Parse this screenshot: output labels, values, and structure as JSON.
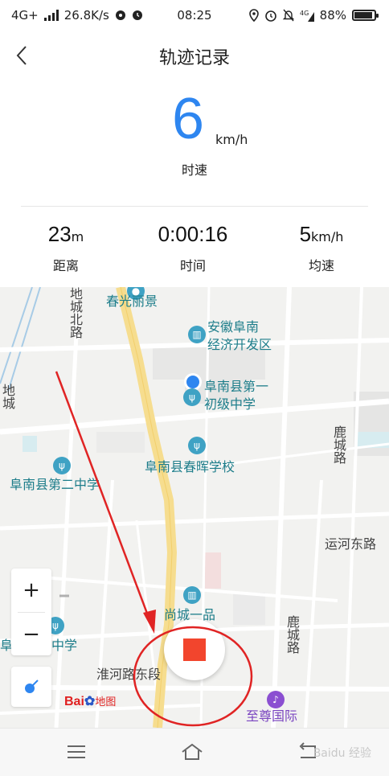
{
  "status_bar": {
    "network": "4G+",
    "speed": "26.8K/s",
    "time": "08:25",
    "battery_text": "88%",
    "battery_level": 0.88,
    "icons": [
      "location-pin-icon",
      "alarm-icon",
      "mute-icon",
      "4g-icon",
      "battery-icon"
    ]
  },
  "header": {
    "title": "轨迹记录",
    "back_icon": "chevron-left-icon"
  },
  "speed": {
    "value": "6",
    "unit": "km/h",
    "label": "时速",
    "color": "#2e86f0"
  },
  "stats": {
    "distance": {
      "value": "23",
      "unit": "m",
      "label": "距离"
    },
    "time": {
      "value": "0:00:16",
      "unit": "",
      "label": "时间"
    },
    "avg_speed": {
      "value": "5",
      "unit": "km/h",
      "label": "均速"
    }
  },
  "map": {
    "pois": {
      "chunguang": "春光丽景",
      "anhui_line1": "安徽阜南",
      "anhui_line2": "经济开发区",
      "first_line1": "阜南县第一",
      "first_line2": "初级中学",
      "chunhui": "阜南县春晖学校",
      "second": "阜南县第二中学",
      "shangcheng": "尚城一品",
      "shiyan": "阜南实验中学",
      "zhizun": "至尊国际"
    },
    "roads": {
      "dicheng_north": "地城北路",
      "dicheng": "地城",
      "lucheng1": "鹿城路",
      "lucheng2": "鹿城路",
      "yunhe_east": "运河东路",
      "huaihe_east": "淮河路东段"
    },
    "zoom_in": "+",
    "zoom_out": "−",
    "logo_text": "Bai",
    "logo_map": "地图"
  },
  "colors": {
    "accent": "#2e86f0",
    "stop": "#f2452d",
    "annotation": "#e02424",
    "poi": "#1d7d8a"
  },
  "nav": {
    "watermark": "Baidu 经验"
  }
}
